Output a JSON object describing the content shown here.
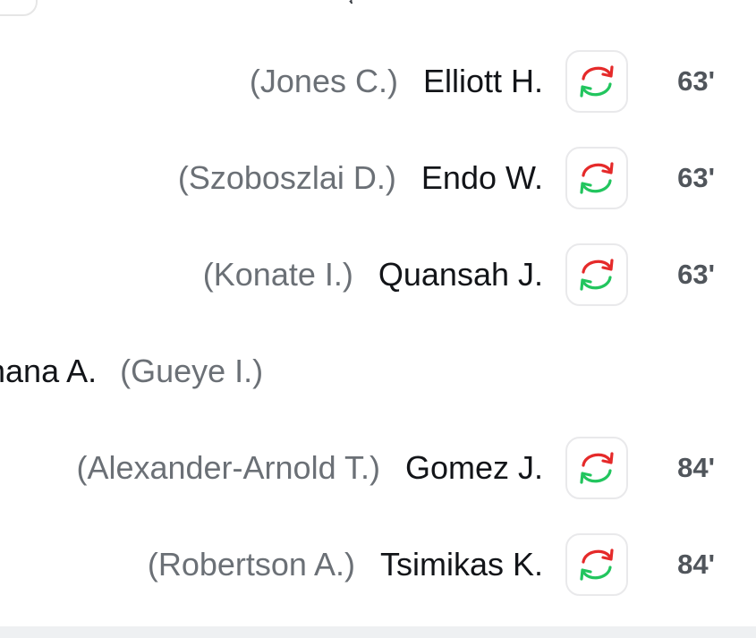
{
  "top_remnant": {
    "text": "( )"
  },
  "substitutions": [
    {
      "player_in": "Elliott H.",
      "player_out": "(Jones C.)",
      "minute": "63'"
    },
    {
      "player_in": "Endo W.",
      "player_out": "(Szoboszlai D.)",
      "minute": "63'"
    },
    {
      "player_in": "Quansah J.",
      "player_out": "(Konate I.)",
      "minute": "63'"
    },
    {
      "player_in": "Gomez J.",
      "player_out": "(Alexander-Arnold T.)",
      "minute": "84'"
    },
    {
      "player_in": "Tsimikas K.",
      "player_out": "(Robertson A.)",
      "minute": "84'"
    }
  ],
  "away_substitution": {
    "player_in": "hana A.",
    "player_out": "(Gueye I.)"
  },
  "icons": {
    "substitution": "substitution-arrows-icon"
  },
  "colors": {
    "sub_in_green": "#22c55e",
    "sub_out_red": "#e52a2a"
  }
}
